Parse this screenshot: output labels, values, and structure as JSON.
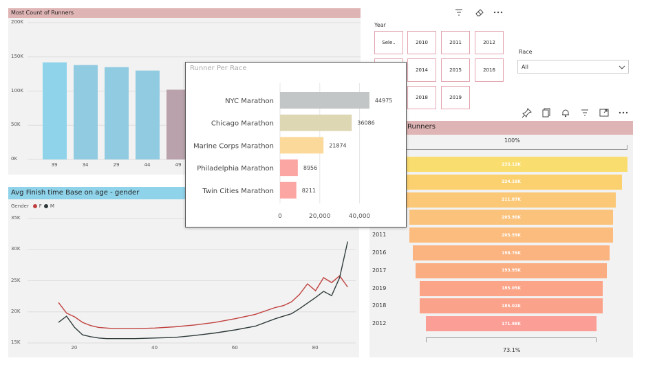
{
  "colors": {
    "bar_blue_a": "#8fd3ea",
    "bar_blue_b": "#90cbe1",
    "bar_mauve": "#b9a2ac",
    "title_pink": "#dfb4b4",
    "title_blue": "#8fd3ea",
    "series_f": "#c0403e",
    "series_m": "#2e3a3a",
    "slicer_border": "#e3a3ae"
  },
  "toolbar_top": {
    "icons": [
      "filter-icon",
      "eraser-icon",
      "more-icon"
    ]
  },
  "toolbar_funnel": {
    "icons": [
      "pin-icon",
      "copy-icon",
      "bell-icon",
      "filter-icon",
      "expand-icon",
      "more-icon"
    ]
  },
  "year_slicer": {
    "label": "Year",
    "items": [
      "Sele..",
      "2010",
      "2011",
      "2012",
      "",
      "2014",
      "2015",
      "2016",
      "",
      "2018",
      "2019"
    ]
  },
  "race_slicer": {
    "label": "Race",
    "selected": "All"
  },
  "runners_chart": {
    "title": "Most Count of Runners",
    "y_ticks": [
      "200K",
      "150K",
      "100K",
      "50K",
      "0K"
    ],
    "chart_data": {
      "type": "bar",
      "categories": [
        "39",
        "34",
        "29",
        "44",
        "49"
      ],
      "values": [
        142000,
        138000,
        135000,
        130000,
        102000
      ],
      "ylim": [
        0,
        200000
      ]
    }
  },
  "finish_chart": {
    "title": "Avg Finish time Base on age - gender",
    "legend_label": "Gender",
    "legend_items": [
      "F",
      "M"
    ],
    "y_ticks": [
      "35K",
      "30K",
      "25K",
      "20K",
      "15K"
    ],
    "x_ticks": [
      "20",
      "40",
      "60",
      "80"
    ],
    "chart_data": {
      "type": "line",
      "xlim": [
        10,
        90
      ],
      "ylim": [
        15000,
        35000
      ],
      "series": [
        {
          "name": "F",
          "x": [
            16,
            18,
            20,
            22,
            24,
            26,
            28,
            30,
            35,
            40,
            45,
            50,
            55,
            60,
            65,
            70,
            72,
            74,
            76,
            78,
            80,
            82,
            84,
            86,
            88
          ],
          "y": [
            21500,
            19800,
            19200,
            18300,
            17800,
            17500,
            17400,
            17300,
            17300,
            17400,
            17600,
            17900,
            18300,
            18900,
            19600,
            20700,
            21000,
            21600,
            22800,
            24500,
            23400,
            25500,
            24700,
            25800,
            24000
          ]
        },
        {
          "name": "M",
          "x": [
            16,
            18,
            20,
            22,
            24,
            26,
            28,
            30,
            35,
            40,
            45,
            50,
            55,
            60,
            65,
            70,
            72,
            74,
            76,
            78,
            80,
            82,
            84,
            86,
            88
          ],
          "y": [
            18300,
            19300,
            17500,
            16300,
            16000,
            15800,
            15700,
            15700,
            15700,
            15800,
            15900,
            16200,
            16600,
            17100,
            17700,
            18900,
            19300,
            19700,
            20500,
            21400,
            22300,
            23300,
            22600,
            25500,
            31300
          ]
        }
      ]
    }
  },
  "race_tooltip": {
    "title": "Runner Per Race",
    "x_ticks": [
      "0",
      "20,000",
      "40,000"
    ],
    "chart_data": {
      "type": "bar",
      "orientation": "horizontal",
      "categories": [
        "NYC Marathon",
        "Chicago Marathon",
        "Marine Corps Marathon",
        "Philadelphia Marathon",
        "Twin Cities Marathon"
      ],
      "values": [
        44975,
        36086,
        21874,
        8956,
        8211
      ],
      "labels": [
        "44975",
        "36086",
        "21874",
        "8956",
        "8211"
      ],
      "colors": [
        "#c3c6c6",
        "#ddd7b3",
        "#fbd99a",
        "#fba6a3",
        "#fba6a3"
      ],
      "xlim": [
        0,
        45000
      ]
    }
  },
  "funnel": {
    "title": "Runners",
    "top_pct": "100%",
    "bottom_pct": "73.1%",
    "chart_data": {
      "type": "bar",
      "categories": [
        "",
        "",
        "",
        "",
        "2011",
        "2016",
        "2017",
        "2019",
        "2018",
        "2012"
      ],
      "values": [
        235120,
        224160,
        211870,
        205900,
        205590,
        198760,
        193950,
        185050,
        185020,
        171980
      ],
      "labels": [
        "235.12K",
        "224.16K",
        "211.87K",
        "205.90K",
        "205.59K",
        "198.76K",
        "193.95K",
        "185.05K",
        "185.02K",
        "171.98K"
      ],
      "colors": [
        "#f9dd6e",
        "#fbd16f",
        "#fbc878",
        "#fbc27c",
        "#fbbc7e",
        "#fbb380",
        "#fbad82",
        "#fba487",
        "#fba38a",
        "#fb9e96"
      ]
    }
  }
}
